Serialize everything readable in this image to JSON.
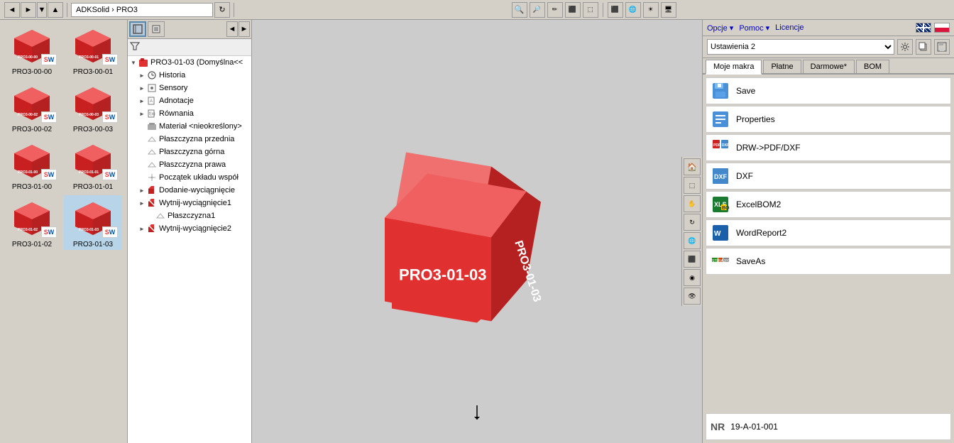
{
  "header": {
    "nav_back": "◄",
    "nav_forward": "►",
    "nav_up": "▲",
    "breadcrumb": "ADKSolid › PRO3",
    "refresh": "↻"
  },
  "top_toolbar": {
    "buttons": [
      "🔍",
      "🔍",
      "✏",
      "⬛",
      "⬛",
      "🔵",
      "🌐",
      "⚙",
      "🖥"
    ]
  },
  "tree": {
    "root_label": "PRO3-01-03  (Domyślna<<",
    "items": [
      {
        "id": "historia",
        "label": "Historia",
        "icon": "clock",
        "indent": 1,
        "expandable": true
      },
      {
        "id": "sensory",
        "label": "Sensory",
        "icon": "sensor",
        "indent": 1,
        "expandable": true
      },
      {
        "id": "adnotacje",
        "label": "Adnotacje",
        "icon": "annotation",
        "indent": 1,
        "expandable": true
      },
      {
        "id": "rownania",
        "label": "Równania",
        "icon": "formula",
        "indent": 1,
        "expandable": true
      },
      {
        "id": "material",
        "label": "Materiał <nieokreślony>",
        "icon": "material",
        "indent": 1,
        "expandable": false
      },
      {
        "id": "plaszczyzna_przednia",
        "label": "Płaszczyzna przednia",
        "icon": "plane",
        "indent": 1,
        "expandable": false
      },
      {
        "id": "plaszczyzna_gorna",
        "label": "Płaszczyzna górna",
        "icon": "plane",
        "indent": 1,
        "expandable": false
      },
      {
        "id": "plaszczyzna_prawa",
        "label": "Płaszczyzna prawa",
        "icon": "plane",
        "indent": 1,
        "expandable": false
      },
      {
        "id": "poczatek",
        "label": "Początek układu współ",
        "icon": "origin",
        "indent": 1,
        "expandable": false
      },
      {
        "id": "dodanie",
        "label": "Dodanie-wyciągnięcie",
        "icon": "extrude",
        "indent": 1,
        "expandable": true
      },
      {
        "id": "wytnij1",
        "label": "Wytnij-wyciągnięcie1",
        "icon": "cut",
        "indent": 1,
        "expandable": true
      },
      {
        "id": "plaszczyzna1",
        "label": "Płaszczyzna1",
        "icon": "plane",
        "indent": 2,
        "expandable": false
      },
      {
        "id": "wytnij2",
        "label": "Wytnij-wyciągnięcie2",
        "icon": "cut",
        "indent": 1,
        "expandable": true
      }
    ]
  },
  "files": [
    {
      "name": "PRO3-00-00",
      "id": "f1"
    },
    {
      "name": "PRO3-00-01",
      "id": "f2"
    },
    {
      "name": "PRO3-00-02",
      "id": "f3"
    },
    {
      "name": "PRO3-00-03",
      "id": "f4"
    },
    {
      "name": "PRO3-01-00",
      "id": "f5"
    },
    {
      "name": "PRO3-01-01",
      "id": "f6"
    },
    {
      "name": "PRO3-01-02",
      "id": "f7"
    },
    {
      "name": "PRO3-01-03",
      "id": "f8"
    }
  ],
  "right_panel": {
    "menu_items": [
      "Opcje",
      "Pomoc",
      "Licencje"
    ],
    "settings_value": "Ustawienia 2",
    "tabs": [
      "Moje makra",
      "Płatne",
      "Darmowe*",
      "BOM"
    ],
    "active_tab": "Moje makra",
    "macros": [
      {
        "id": "save",
        "label": "Save",
        "icon": "save"
      },
      {
        "id": "properties",
        "label": "Properties",
        "icon": "properties"
      },
      {
        "id": "drw_pdf_dxf",
        "label": "DRW->PDF/DXF",
        "icon": "drw-pdf"
      },
      {
        "id": "dxf",
        "label": "DXF",
        "icon": "dxf"
      },
      {
        "id": "excelbom2",
        "label": "ExcelBOM2",
        "icon": "excel"
      },
      {
        "id": "wordreport2",
        "label": "WordReport2",
        "icon": "word"
      },
      {
        "id": "saveas",
        "label": "SaveAs",
        "icon": "saveas"
      }
    ],
    "nr_label": "NR",
    "nr_value": "19-A-01-001"
  },
  "viewport": {
    "model_label_front": "PRO3-01-03",
    "model_label_side": "PRO3-01-03",
    "cursor_symbol": "↑"
  },
  "colors": {
    "cube_red": "#e03030",
    "cube_red_dark": "#b52020",
    "cube_red_top": "#f06060",
    "tree_bg": "#ffffff",
    "panel_bg": "#d4d0c8"
  }
}
